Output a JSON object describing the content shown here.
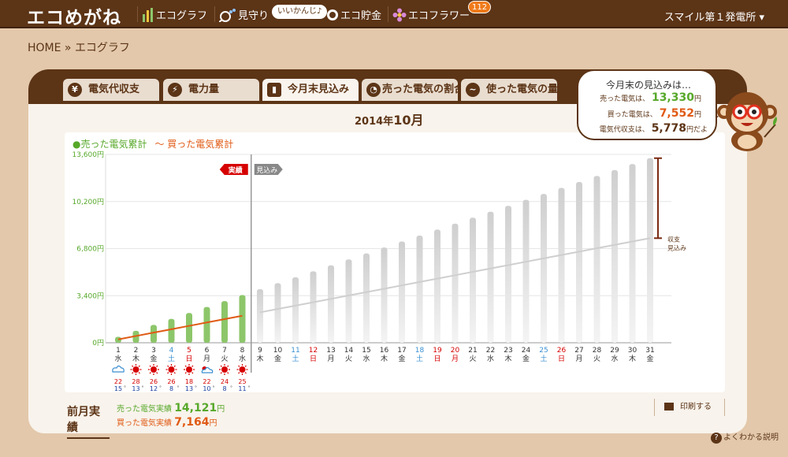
{
  "header": {
    "logo": "エコめがね",
    "nav": [
      {
        "label": "エコグラフ",
        "icon": "graph-icon"
      },
      {
        "label": "見守り",
        "icon": "binoculars-icon"
      },
      {
        "label": "エコ貯金",
        "icon": "coin-icon"
      },
      {
        "label": "エコフラワー",
        "icon": "flower-icon"
      }
    ],
    "status_bubble": "いいかんじ♪",
    "flower_badge": "112",
    "plant_name": "スマイル第１発電所"
  },
  "breadcrumb": "HOME » エコグラフ",
  "tabs": [
    {
      "label": "電気代収支",
      "icon": "yen-icon"
    },
    {
      "label": "電力量",
      "icon": "bolt-icon"
    },
    {
      "label": "今月末見込み",
      "icon": "forecast-icon",
      "active": true
    },
    {
      "label": "売った電気の割合",
      "icon": "pie-icon"
    },
    {
      "label": "使った電気の量",
      "icon": "wave-icon"
    }
  ],
  "month": {
    "year": "2014年",
    "month": "10月"
  },
  "forecast": {
    "title": "今月末の見込みは…",
    "sold_label": "売った電気は、",
    "sold_value": "13,330",
    "bought_label": "買った電気は、",
    "bought_value": "7,552",
    "balance_label": "電気代収支は、",
    "balance_value": "5,778",
    "yen": "円",
    "yen_dayo": "円だよ"
  },
  "legend": {
    "sold": "●売った電気累計",
    "bought": "〜 買った電気累計"
  },
  "colors": {
    "sold": "#8dc66a",
    "bought": "#e05a14",
    "forecast": "#cfcfcf",
    "brown": "#5c3416",
    "saturday": "#3a8fd1",
    "holiday": "#d60000"
  },
  "chart_data": {
    "type": "bar",
    "title": "",
    "xlabel": "",
    "ylabel": "",
    "ylim": [
      0,
      13600
    ],
    "yticks": [
      "0円",
      "3,400円",
      "6,800円",
      "10,200円",
      "13,600円"
    ],
    "ytick_values": [
      0,
      3400,
      6800,
      10200,
      13600
    ],
    "grid": true,
    "actual_tag": "実績",
    "forecast_tag": "見込み",
    "range_label": "収支\n見込み",
    "days": [
      "1",
      "2",
      "3",
      "4",
      "5",
      "6",
      "7",
      "8",
      "9",
      "10",
      "11",
      "12",
      "13",
      "14",
      "15",
      "16",
      "17",
      "18",
      "19",
      "20",
      "21",
      "22",
      "23",
      "24",
      "25",
      "26",
      "27",
      "28",
      "29",
      "30",
      "31"
    ],
    "weekdays": [
      "水",
      "木",
      "金",
      "土",
      "日",
      "月",
      "火",
      "水",
      "木",
      "金",
      "土",
      "日",
      "月",
      "火",
      "水",
      "木",
      "金",
      "土",
      "日",
      "月",
      "火",
      "水",
      "木",
      "金",
      "土",
      "日",
      "月",
      "火",
      "水",
      "木",
      "金"
    ],
    "day_types": [
      "",
      "",
      "",
      "sat",
      "hol",
      "",
      "",
      "",
      "",
      "",
      "sat",
      "hol",
      "",
      "",
      "",
      "",
      "",
      "sat",
      "hol",
      "hol",
      "",
      "",
      "",
      "",
      "sat",
      "hol",
      "",
      "",
      "",
      "",
      ""
    ],
    "series": [
      {
        "name": "売った電気累計",
        "kind": "actual_bar",
        "values": [
          430,
          860,
          1290,
          1720,
          2150,
          2580,
          3010,
          3440
        ]
      },
      {
        "name": "",
        "kind": "forecast_bar",
        "values": [
          null,
          null,
          null,
          null,
          null,
          null,
          null,
          null,
          3870,
          4300,
          4730,
          5160,
          5590,
          6020,
          6450,
          6880,
          7310,
          7740,
          8170,
          8600,
          9030,
          9460,
          9890,
          10320,
          10750,
          11180,
          11610,
          12040,
          12470,
          12900,
          13330
        ]
      },
      {
        "name": "買った電気累計",
        "kind": "actual_line",
        "values": [
          244,
          488,
          731,
          975,
          1219,
          1463,
          1706,
          1950
        ]
      },
      {
        "name": "",
        "kind": "forecast_line",
        "values": [
          null,
          null,
          null,
          null,
          null,
          null,
          null,
          null,
          2194,
          2438,
          2682,
          2925,
          3169,
          3413,
          3657,
          3900,
          4144,
          4388,
          4632,
          4876,
          5120,
          5363,
          5607,
          5851,
          6095,
          6338,
          6582,
          6826,
          7070,
          7314,
          7552
        ]
      }
    ],
    "weather": [
      {
        "icon": "cloud-icon",
        "high": "22",
        "low": "15"
      },
      {
        "icon": "sun-icon",
        "high": "28",
        "low": "13"
      },
      {
        "icon": "sun-icon",
        "high": "26",
        "low": "12"
      },
      {
        "icon": "sun-icon",
        "high": "26",
        "low": "8"
      },
      {
        "icon": "sun-icon",
        "high": "18",
        "low": "13"
      },
      {
        "icon": "cloud-sun-icon",
        "high": "22",
        "low": "10"
      },
      {
        "icon": "sun-icon",
        "high": "24",
        "low": "8"
      },
      {
        "icon": "sun-icon",
        "high": "25",
        "low": "11"
      }
    ],
    "degree": "°"
  },
  "previous": {
    "title": "前月実績",
    "sold_label": "売った電気実績",
    "sold_value": "14,121",
    "bought_label": "買った電気実績",
    "bought_value": "7,164",
    "yen": "円"
  },
  "print_label": "印刷する",
  "help_label": "よくわかる説明"
}
